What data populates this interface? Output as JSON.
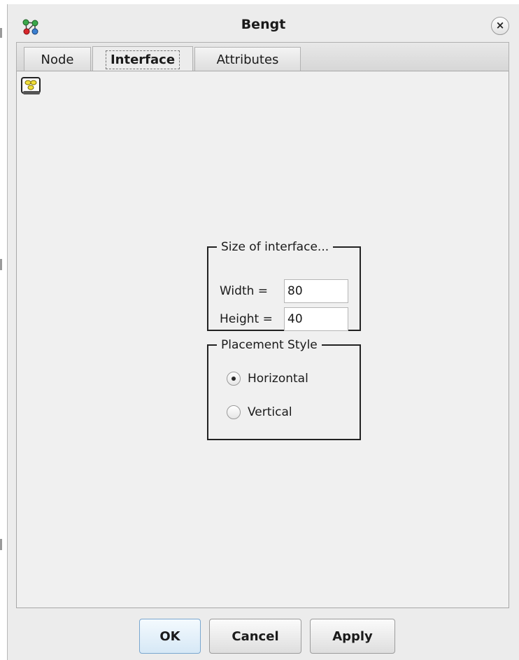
{
  "window": {
    "title": "Bengt",
    "close_label": "×",
    "app_icon": "node-graph-icon",
    "close_icon": "close-icon"
  },
  "tabs": [
    {
      "label": "Node",
      "active": false
    },
    {
      "label": "Interface",
      "active": true
    },
    {
      "label": "Attributes",
      "active": false
    }
  ],
  "panel": {
    "icon": "interface-shape-icon",
    "size_group": {
      "legend": "Size of interface...",
      "width_label": "Width =",
      "width_value": "80",
      "height_label": "Height =",
      "height_value": "40"
    },
    "placement_group": {
      "legend": "Placement Style",
      "options": [
        {
          "label": "Horizontal",
          "checked": true
        },
        {
          "label": "Vertical",
          "checked": false
        }
      ]
    }
  },
  "footer": {
    "ok_label": "OK",
    "cancel_label": "Cancel",
    "apply_label": "Apply"
  },
  "colors": {
    "window_bg": "#ececec",
    "panel_bg": "#f0f0f0",
    "ok_accent": "#7aa7cf"
  }
}
